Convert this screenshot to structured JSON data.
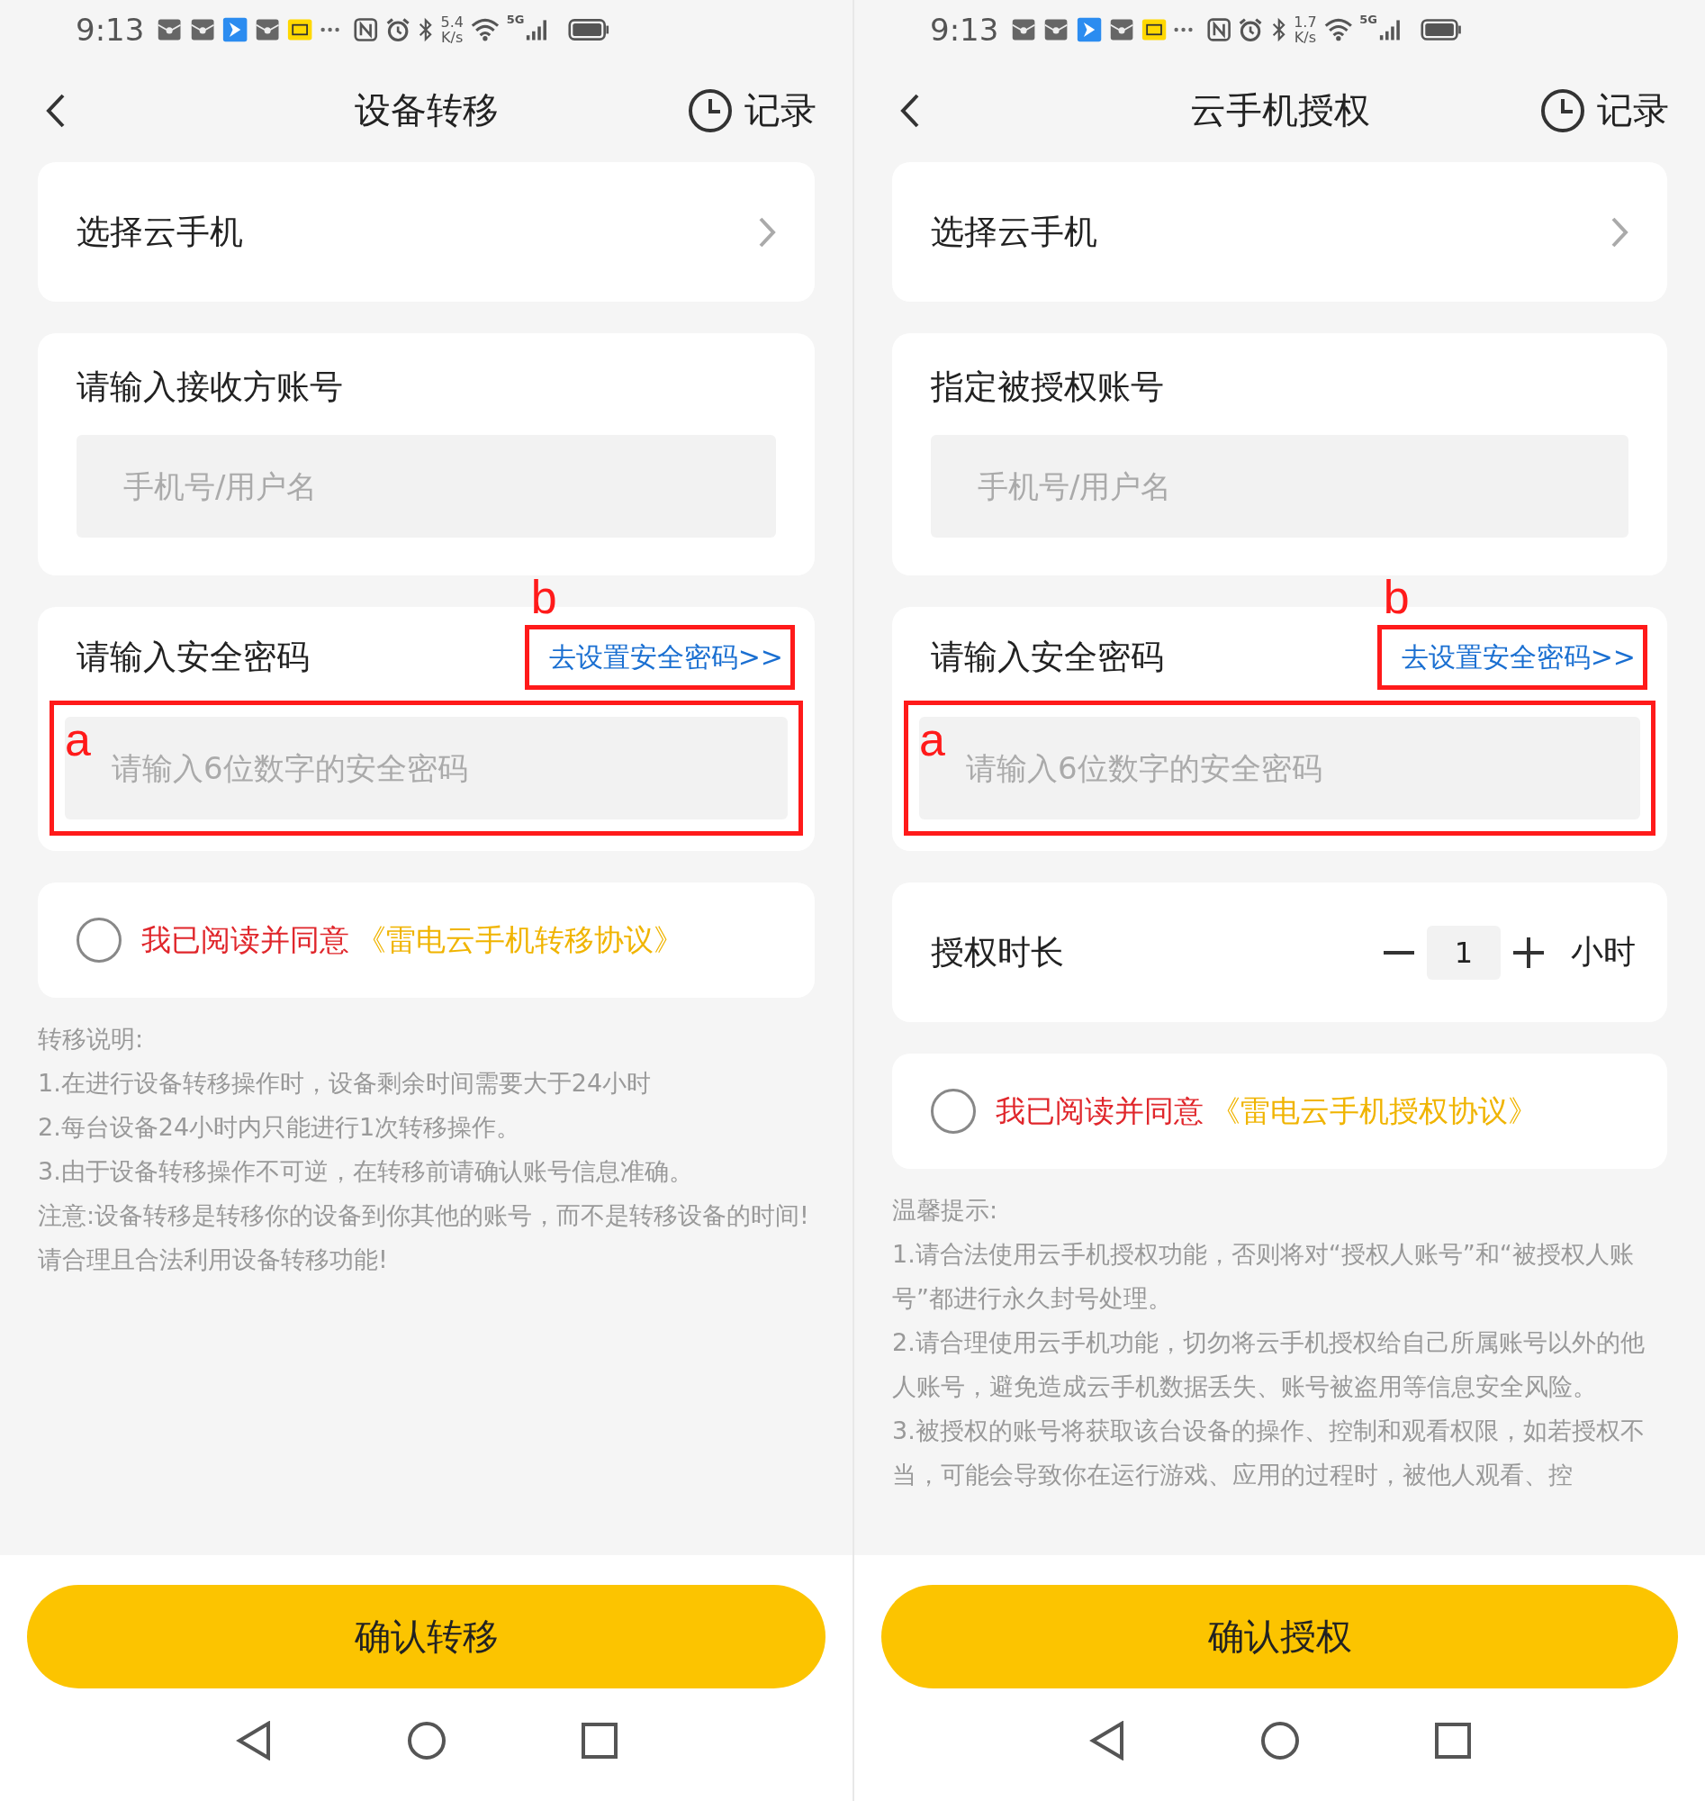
{
  "panels": [
    {
      "status_bar": {
        "time": "9:13",
        "speed": "5.4",
        "speed_unit": "K/s",
        "network": "5G"
      },
      "header": {
        "title": "设备转移",
        "history": "记录"
      },
      "select": {
        "label": "选择云手机"
      },
      "account": {
        "label": "请输入接收方账号",
        "placeholder": "手机号/用户名"
      },
      "password": {
        "label": "请输入安全密码",
        "link": "去设置安全密码>>",
        "placeholder": "请输入6位数字的安全密码",
        "link_mark": "b",
        "input_mark": "a"
      },
      "agreement": {
        "checked": false,
        "text": "我已阅读并同意",
        "link": "《雷电云手机转移协议》"
      },
      "notes": [
        "转移说明:",
        "1.在进行设备转移操作时，设备剩余时间需要大于24小时",
        "2.每台设备24小时内只能进行1次转移操作。",
        "3.由于设备转移操作不可逆，在转移前请确认账号信息准确。",
        "注意:设备转移是转移你的设备到你其他的账号，而不是转移设备的时间!请合理且合法利用设备转移功能!"
      ],
      "button": "确认转移"
    },
    {
      "status_bar": {
        "time": "9:13",
        "speed": "1.7",
        "speed_unit": "K/s",
        "network": "5G"
      },
      "header": {
        "title": "云手机授权",
        "history": "记录"
      },
      "select": {
        "label": "选择云手机"
      },
      "account": {
        "label": "指定被授权账号",
        "placeholder": "手机号/用户名"
      },
      "password": {
        "label": "请输入安全密码",
        "link": "去设置安全密码>>",
        "placeholder": "请输入6位数字的安全密码",
        "link_mark": "b",
        "input_mark": "a"
      },
      "duration": {
        "label": "授权时长",
        "value": "1",
        "unit": "小时"
      },
      "agreement": {
        "checked": false,
        "text": "我已阅读并同意",
        "link": "《雷电云手机授权协议》"
      },
      "notes": [
        "温馨提示:",
        "1.请合法使用云手机授权功能，否则将对“授权人账号”和“被授权人账号”都进行永久封号处理。",
        "2.请合理使用云手机功能，切勿将云手机授权给自己所属账号以外的他人账号，避免造成云手机数据丢失、账号被盗用等信息安全风险。",
        "3.被授权的账号将获取该台设备的操作、控制和观看权限，如若授权不当，可能会导致你在运行游戏、应用的过程时，被他人观看、控"
      ],
      "button": "确认授权"
    }
  ]
}
